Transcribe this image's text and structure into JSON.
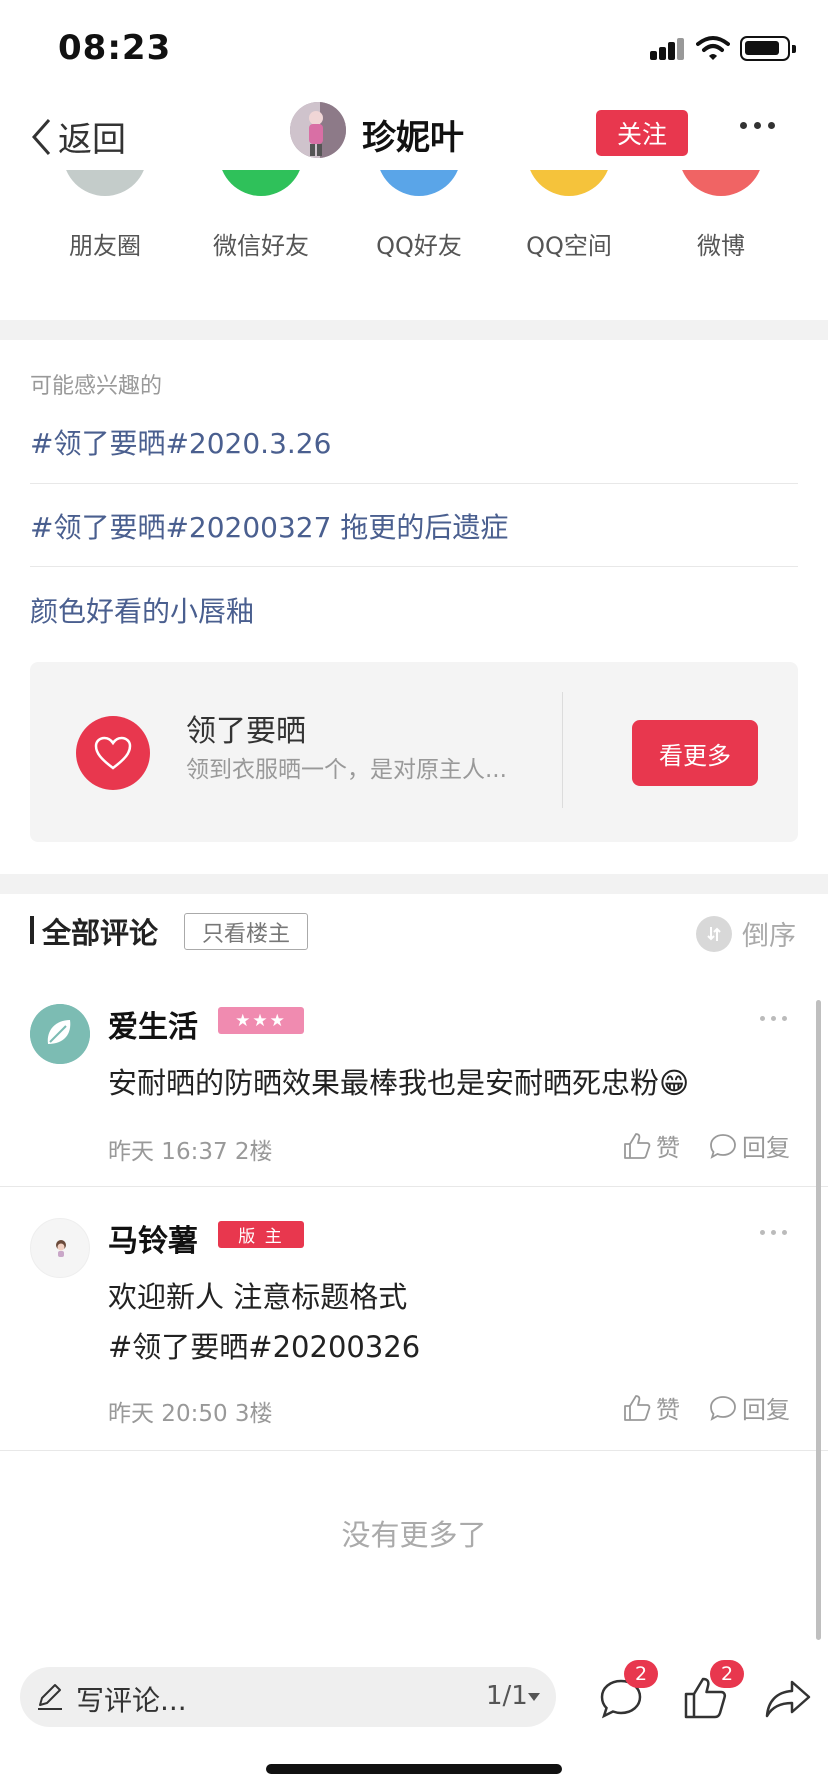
{
  "status_bar": {
    "time": "08:23"
  },
  "nav": {
    "back_label": "返回",
    "user_name": "珍妮叶",
    "follow_label": "关注"
  },
  "share": {
    "items": [
      {
        "label": "朋友圈",
        "icon": "moments-icon",
        "color": "#bfc6c4"
      },
      {
        "label": "微信好友",
        "icon": "wechat-icon",
        "color": "#2fc15a"
      },
      {
        "label": "QQ好友",
        "icon": "qq-icon",
        "color": "#5aa5e8"
      },
      {
        "label": "QQ空间",
        "icon": "qzone-icon",
        "color": "#f5c33b"
      },
      {
        "label": "微博",
        "icon": "weibo-icon",
        "color": "#f06464"
      }
    ]
  },
  "interests": {
    "title": "可能感兴趣的",
    "topics": [
      "#领了要晒#2020.3.26",
      "#领了要晒#20200327 拖更的后遗症",
      "颜色好看的小唇釉"
    ]
  },
  "card": {
    "title": "领了要晒",
    "subtitle": "领到衣服晒一个，是对原主人...",
    "button_label": "看更多"
  },
  "comments_header": {
    "title": "全部评论",
    "owner_only_label": "只看楼主",
    "sort_label": "倒序"
  },
  "comments": [
    {
      "name": "爱生活",
      "badge": "★★★",
      "badge_color": "#f08bb0",
      "lines": [
        "安耐晒的防晒效果最棒我也是安耐晒死忠粉😁"
      ],
      "meta": "昨天 16:37  2楼",
      "like_label": "赞",
      "reply_label": "回复"
    },
    {
      "name": "马铃薯",
      "badge": "版 主",
      "badge_color": "#e8374e",
      "lines": [
        "欢迎新人 注意标题格式",
        "#领了要晒#20200326"
      ],
      "meta": "昨天 20:50  3楼",
      "like_label": "赞",
      "reply_label": "回复"
    }
  ],
  "no_more_label": "没有更多了",
  "bottom_bar": {
    "input_placeholder": "写评论...",
    "page_indicator": "1/1",
    "comment_count": "2",
    "like_count": "2"
  },
  "colors": {
    "accent": "#e8374e",
    "link": "#4a5f8f"
  }
}
